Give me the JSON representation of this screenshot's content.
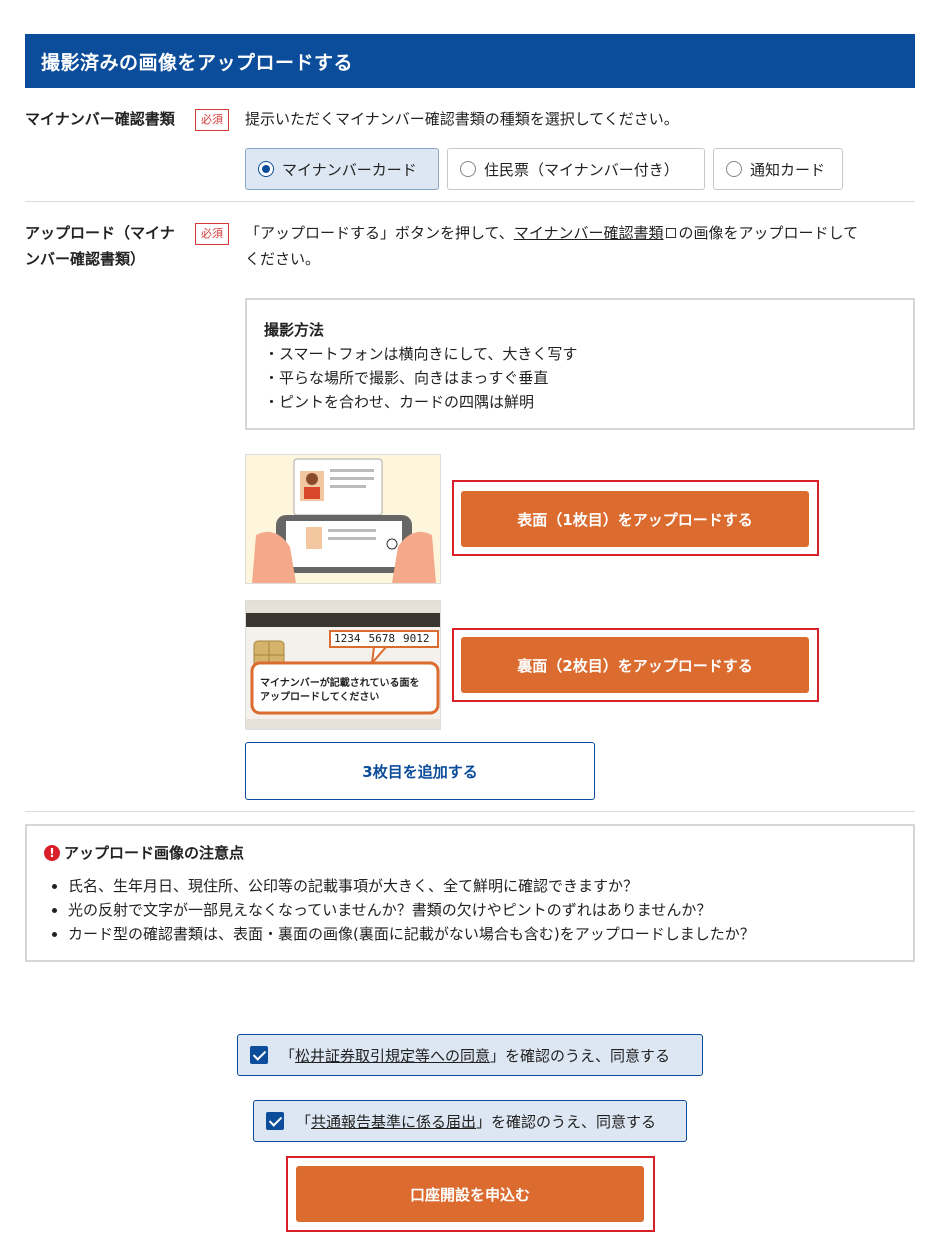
{
  "section": {
    "title": "撮影済みの画像をアップロードする"
  },
  "doc_type": {
    "label": "マイナンバー確認書類",
    "required_badge": "必須",
    "description": "提示いただくマイナンバー確認書類の種類を選択してください。",
    "options": [
      {
        "label": "マイナンバーカード",
        "selected": true
      },
      {
        "label": "住民票（マイナンバー付き）",
        "selected": false
      },
      {
        "label": "通知カード",
        "selected": false
      }
    ]
  },
  "upload": {
    "label_line1": "アップロード（マイナ",
    "label_line2": "ンバー確認書類）",
    "required_badge": "必須",
    "desc_before": "「アップロードする」ボタンを押して、",
    "desc_link": "マイナンバー確認書類",
    "desc_after": "の画像をアップロードして",
    "desc_line2": "ください。",
    "method": {
      "title": "撮影方法",
      "items": [
        "・スマートフォンは横向きにして、大きく写す",
        "・平らな場所で撮影、向きはまっすぐ垂直",
        "・ピントを合わせ、カードの四隅は鮮明"
      ]
    },
    "front_button": "表面（1枚目）をアップロードする",
    "back_button": "裏面（2枚目）をアップロードする",
    "add_button": "3枚目を追加する",
    "back_image": {
      "number_groups": [
        "1234",
        "5678",
        "9012"
      ],
      "callout_line1": "マイナンバーが記載されている面を",
      "callout_line2": "アップロードしてください"
    }
  },
  "notice": {
    "title": "アップロード画像の注意点",
    "items": [
      "氏名、生年月日、現住所、公印等の記載事項が大きく、全て鮮明に確認できますか？",
      "光の反射で文字が一部見えなくなっていませんか？書類の欠けやピントのずれはありませんか？",
      "カード型の確認書類は、表面・裏面の画像(裏面に記載がない場合も含む)をアップロードしましたか？"
    ]
  },
  "agreements": [
    {
      "prefix": "「",
      "link": "松井証券取引規定等への同意",
      "suffix": "」を確認のうえ、同意する",
      "checked": true
    },
    {
      "prefix": "「",
      "link": "共通報告基準に係る届出",
      "suffix": "」を確認のうえ、同意する",
      "checked": true
    }
  ],
  "submit": {
    "label": "口座開設を申込む"
  },
  "colors": {
    "primary": "#0c4d9b",
    "accent": "#dc6b2f",
    "highlight": "#d8202b"
  }
}
